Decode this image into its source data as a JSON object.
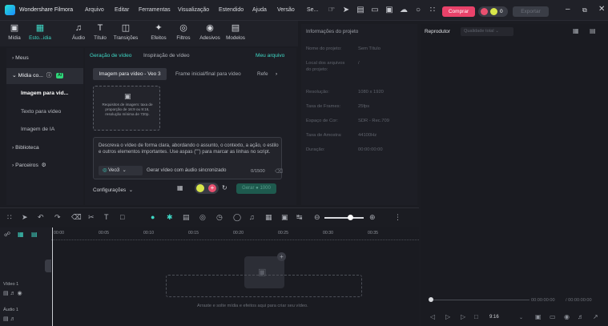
{
  "titlebar": {
    "app_name": "Wondershare Filmora",
    "menu": [
      "Arquivo",
      "Editar",
      "Ferramentas",
      "Visualização",
      "Estendido",
      "Ajuda",
      "Versão",
      "Se..."
    ],
    "buy_label": "Comprar",
    "coins": "0",
    "export_label": "Exportar"
  },
  "toolbar": {
    "tools": [
      {
        "label": "Mídia",
        "icon": "media-icon"
      },
      {
        "label": "Esto...idia",
        "icon": "stock-media-icon"
      },
      {
        "label": "Áudio",
        "icon": "audio-icon"
      },
      {
        "label": "Título",
        "icon": "title-icon"
      },
      {
        "label": "Transições",
        "icon": "transitions-icon"
      },
      {
        "label": "Efeitos",
        "icon": "effects-icon"
      },
      {
        "label": "Filtros",
        "icon": "filters-icon"
      },
      {
        "label": "Adesivos",
        "icon": "stickers-icon"
      },
      {
        "label": "Modelos",
        "icon": "templates-icon"
      }
    ]
  },
  "leftnav": {
    "items": [
      {
        "label": "Meus"
      },
      {
        "label": "Mídia co...",
        "badge": "AI"
      },
      {
        "label": "Imagem para vid..."
      },
      {
        "label": "Texto para vídeo"
      },
      {
        "label": "Imagem de IA"
      },
      {
        "label": "Biblioteca"
      },
      {
        "label": "Parceiros"
      }
    ]
  },
  "center": {
    "tab_video_gen": "Geração de vídeo",
    "tab_inspiration": "Inspiração de vídeo",
    "my_file": "Meu arquivo",
    "seg_image_to_video": "Imagem para vídeo - Veo 3",
    "seg_first_last": "Frame inicial/final para vídeo",
    "seg_ref": "Refe",
    "upload_text": "Requisitos de imagem: taxa de proporção de 16:9 ou 9:16, resolução mínima de 720p.",
    "prompt_placeholder": "Descreva o vídeo de forma clara, abordando o assunto, o contexto, a ação, o estilo e outros elementos importantes. Use aspas (\"\") para marcar as linhas no script.",
    "model": "Veo3",
    "audio_sync": "Gerar vídeo com áudio sincronizado",
    "counter": "0/1500",
    "config_label": "Configurações",
    "toggle_value": "+",
    "generate_label": "Gerar",
    "generate_cost": "1000"
  },
  "project": {
    "title": "Informações do projeto",
    "rows": [
      {
        "label": "Nome do projeto:",
        "value": "Sem Título"
      },
      {
        "label": "Local dos arquivos do projeto:",
        "value": "/"
      },
      {
        "label": "Resolução:",
        "value": "1080 x 1920"
      },
      {
        "label": "Taxa de Frames:",
        "value": "25fps"
      },
      {
        "label": "Espaço de Cor:",
        "value": "SDR - Rec.709"
      },
      {
        "label": "Taxa de Amostra:",
        "value": "44100Hz"
      },
      {
        "label": "Duração:",
        "value": "00:00:00:00"
      }
    ]
  },
  "player": {
    "label": "Reprodutor",
    "quality": "Qualidade total",
    "current_time": "00:00:00:00",
    "total_time": "/ 00:00:00:00",
    "aspect": "9:16"
  },
  "timeline": {
    "ruler": [
      "00:00",
      "00:05",
      "00:10",
      "00:15",
      "00:20",
      "00:25",
      "00:30",
      "00:35"
    ],
    "video_track": "Vídeo 1",
    "audio_track": "Áudio 1",
    "drop_hint": "Arraste e solte mídia e efeitos aqui para criar seu vídeo."
  }
}
